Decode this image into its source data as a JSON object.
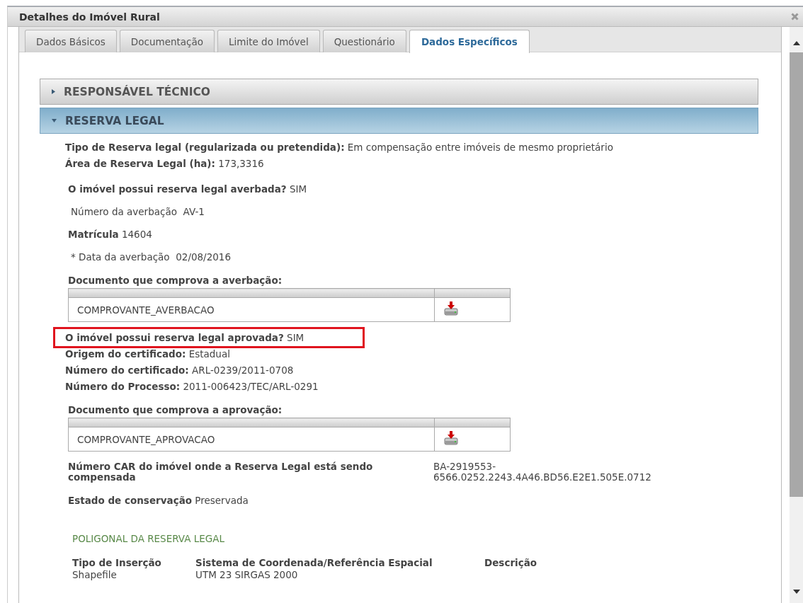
{
  "window": {
    "title": "Detalhes do Imóvel Rural"
  },
  "tabs": [
    {
      "label": "Dados Básicos",
      "selected": false
    },
    {
      "label": "Documentação",
      "selected": false
    },
    {
      "label": "Limite do Imóvel",
      "selected": false
    },
    {
      "label": "Questionário",
      "selected": false
    },
    {
      "label": "Dados Específicos",
      "selected": true
    }
  ],
  "sections": [
    {
      "title": "RESPONSÁVEL TÉCNICO",
      "expanded": false
    },
    {
      "title": "RESERVA LEGAL",
      "expanded": true
    }
  ],
  "details": [
    {
      "kind": "field",
      "label": "Tipo de Reserva legal (regularizada ou pretendida):",
      "value": "Em compensação entre imóveis de mesmo proprietário",
      "highlighted": false
    },
    {
      "kind": "field",
      "label": "Área de Reserva Legal (ha):",
      "value": "173,3316",
      "highlighted": false
    },
    {
      "kind": "field",
      "label": "O imóvel possui reserva legal averbada?",
      "value": "SIM",
      "highlighted": false
    },
    {
      "kind": "plain",
      "label": "Número da averbação",
      "value": "AV-1"
    },
    {
      "kind": "field",
      "label": "Matrícula",
      "value": "14604",
      "highlighted": false
    },
    {
      "kind": "plain",
      "label": "* Data da averbação",
      "value": "02/08/2016"
    },
    {
      "kind": "doc",
      "label": "Documento que comprova a averbação:",
      "file": "COMPROVANTE_AVERBACAO"
    },
    {
      "kind": "field",
      "label": "O imóvel possui reserva legal aprovada?",
      "value": "SIM",
      "highlighted": true
    },
    {
      "kind": "field",
      "label": "Origem do certificado:",
      "value": "Estadual",
      "highlighted": false
    },
    {
      "kind": "field",
      "label": "Número do certificado:",
      "value": "ARL-0239/2011-0708",
      "highlighted": false
    },
    {
      "kind": "field",
      "label": "Número do Processo:",
      "value": "2011-006423/TEC/ARL-0291",
      "highlighted": false
    },
    {
      "kind": "doc",
      "label": "Documento que comprova a aprovação:",
      "file": "COMPROVANTE_APROVACAO"
    },
    {
      "kind": "wide",
      "label": "Número CAR do imóvel onde a Reserva Legal está sendo compensada",
      "value": "BA-2919553-6566.0252.2243.4A46.BD56.E2E1.505E.0712"
    },
    {
      "kind": "field",
      "label": "Estado de conservação",
      "value": "Preservada",
      "highlighted": false
    }
  ],
  "polygon": {
    "title": "POLIGONAL DA RESERVA LEGAL",
    "columns": [
      "Tipo de Inserção",
      "Sistema de Coordenada/Referência Espacial",
      "Descrição"
    ],
    "rows": [
      [
        "Shapefile",
        "UTM 23 SIRGAS 2000",
        ""
      ]
    ]
  }
}
